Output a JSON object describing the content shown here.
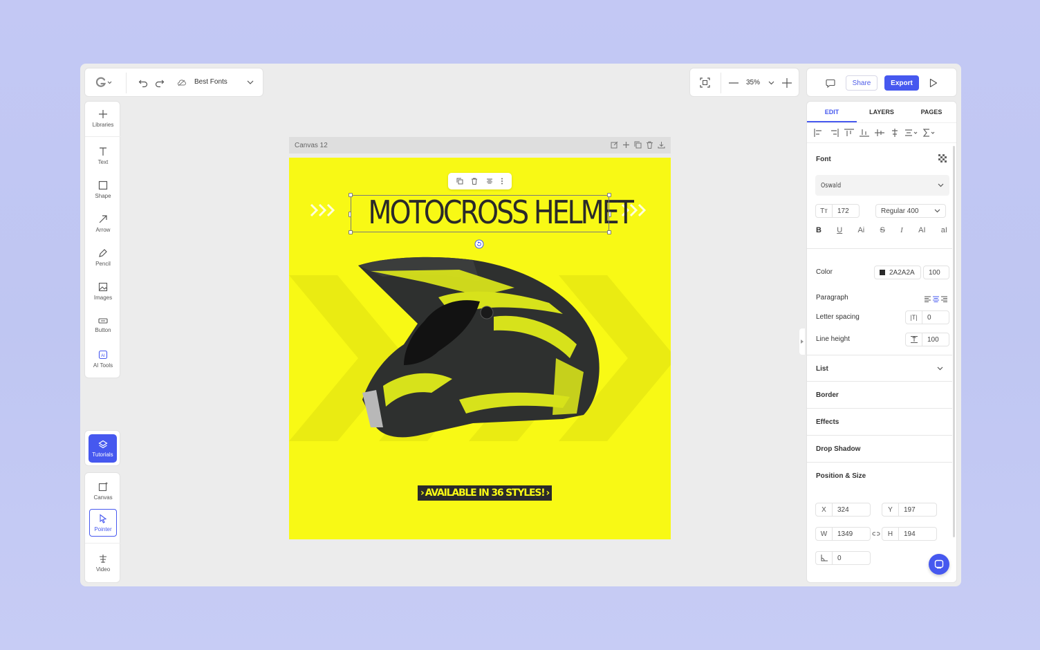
{
  "topbar": {
    "file_name": "Best Fonts",
    "zoom": "35%",
    "share_label": "Share",
    "export_label": "Export"
  },
  "tools": [
    {
      "label": "Libraries",
      "icon": "plus-icon"
    },
    {
      "label": "Text",
      "icon": "text-icon"
    },
    {
      "label": "Shape",
      "icon": "square-icon"
    },
    {
      "label": "Arrow",
      "icon": "arrow-icon"
    },
    {
      "label": "Pencil",
      "icon": "pencil-icon"
    },
    {
      "label": "Images",
      "icon": "image-icon"
    },
    {
      "label": "Button",
      "icon": "button-icon"
    },
    {
      "label": "AI Tools",
      "icon": "ai-icon"
    }
  ],
  "tutorials_label": "Tutorials",
  "bottom_tools": [
    {
      "label": "Canvas",
      "icon": "canvas-icon"
    },
    {
      "label": "Pointer",
      "icon": "pointer-icon"
    },
    {
      "label": "Video",
      "icon": "video-icon"
    }
  ],
  "canvas": {
    "name": "Canvas 12",
    "headline": "MOTOCROSS HELMET",
    "badge": "AVAILABLE IN 36 STYLES!",
    "background": "#f8f915"
  },
  "panel": {
    "tabs": [
      "EDIT",
      "LAYERS",
      "PAGES"
    ],
    "font_title": "Font",
    "font_family": "Oswald",
    "font_size": "172",
    "font_weight": "Regular 400",
    "color_label": "Color",
    "color_hex": "2A2A2A",
    "color_opacity": "100",
    "paragraph_label": "Paragraph",
    "letter_spacing_label": "Letter spacing",
    "letter_spacing": "0",
    "line_height_label": "Line height",
    "line_height": "100",
    "list_label": "List",
    "border_label": "Border",
    "effects_label": "Effects",
    "drop_shadow_label": "Drop Shadow",
    "position_size_label": "Position & Size",
    "x": "324",
    "y": "197",
    "w": "1349",
    "h": "194",
    "rotation": "0",
    "x_label": "X",
    "y_label": "Y",
    "w_label": "W",
    "h_label": "H"
  },
  "accent": "#4658ef"
}
